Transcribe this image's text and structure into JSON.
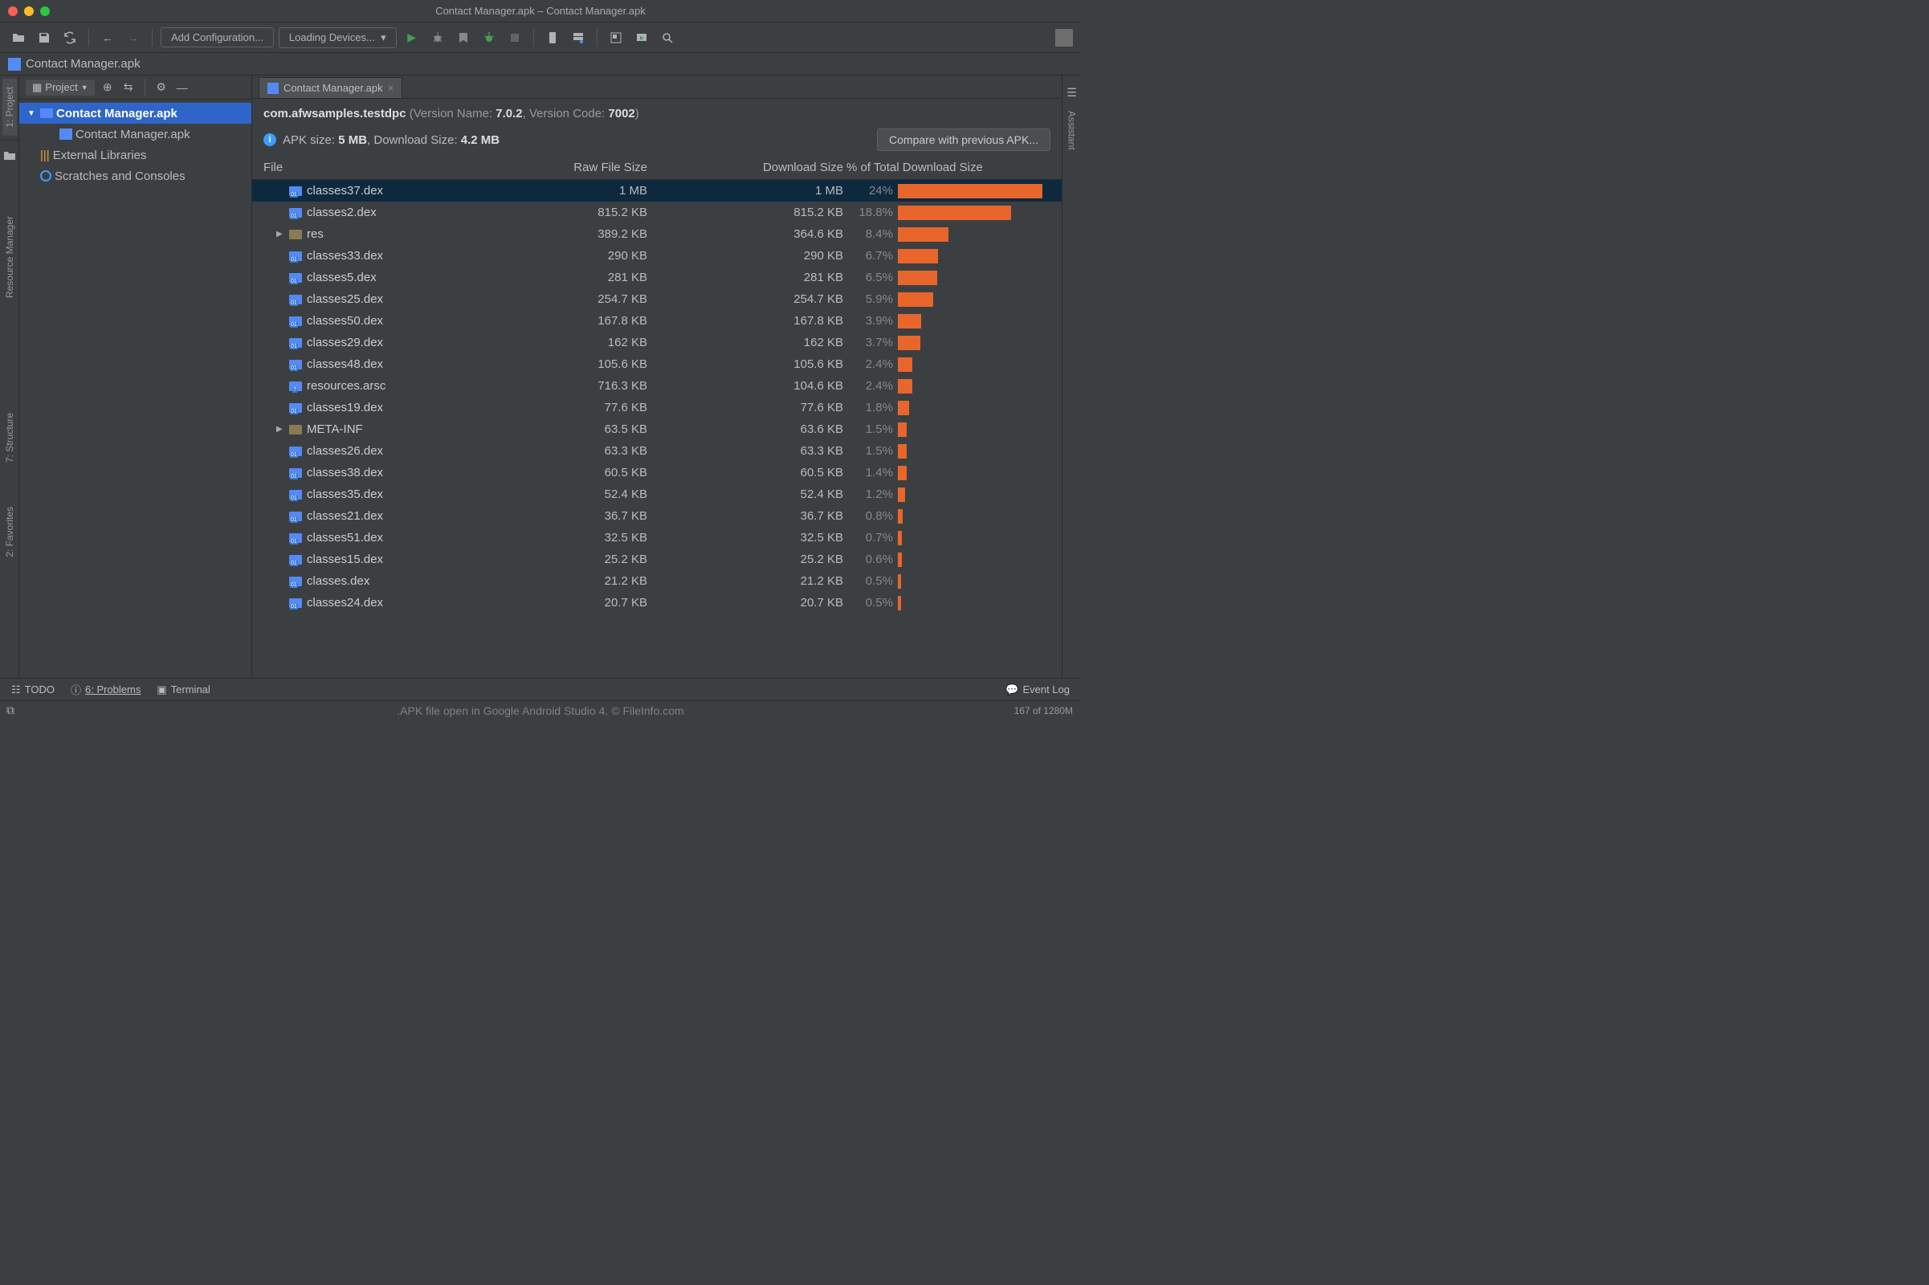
{
  "title": "Contact Manager.apk – Contact Manager.apk",
  "toolbar": {
    "add_config": "Add Configuration...",
    "loading_dev": "Loading Devices..."
  },
  "crumb": "Contact Manager.apk",
  "left_gutter": [
    "1: Project",
    "Resource Manager",
    "7: Structure",
    "2: Favorites"
  ],
  "right_gutter": [
    "Assistant"
  ],
  "sidebar": {
    "title": "Project",
    "tree": [
      {
        "label": "Contact Manager.apk",
        "sel": true,
        "indent": 0,
        "chev": "▼",
        "icon": "proj"
      },
      {
        "label": "Contact Manager.apk",
        "indent": 1,
        "icon": "apk"
      },
      {
        "label": "External Libraries",
        "indent": 0,
        "icon": "lib"
      },
      {
        "label": "Scratches and Consoles",
        "indent": 0,
        "icon": "scr"
      }
    ]
  },
  "tab_label": "Contact Manager.apk",
  "pkg": {
    "name": "com.afwsamples.testdpc",
    "vname_lbl": " (Version Name: ",
    "vname": "7.0.2",
    "vcode_lbl": ", Version Code: ",
    "vcode": "7002",
    "close": ")"
  },
  "sizes": {
    "pre": "APK size: ",
    "apk": "5 MB",
    "mid": ", Download Size: ",
    "dl": "4.2 MB"
  },
  "cmp_btn": "Compare with previous APK...",
  "headers": {
    "file": "File",
    "raw": "Raw File Size",
    "dl": "Download Size",
    "pct": "% of Total Download Size"
  },
  "rows": [
    {
      "f": "classes37.dex",
      "raw": "1 MB",
      "dl": "1 MB",
      "pct": "24%",
      "bar": 24.0,
      "sel": true,
      "ic": "dex"
    },
    {
      "f": "classes2.dex",
      "raw": "815.2 KB",
      "dl": "815.2 KB",
      "pct": "18.8%",
      "bar": 18.8,
      "ic": "dex"
    },
    {
      "f": "res",
      "raw": "389.2 KB",
      "dl": "364.6 KB",
      "pct": "8.4%",
      "bar": 8.4,
      "ic": "fold",
      "chev": true
    },
    {
      "f": "classes33.dex",
      "raw": "290 KB",
      "dl": "290 KB",
      "pct": "6.7%",
      "bar": 6.7,
      "ic": "dex"
    },
    {
      "f": "classes5.dex",
      "raw": "281 KB",
      "dl": "281 KB",
      "pct": "6.5%",
      "bar": 6.5,
      "ic": "dex"
    },
    {
      "f": "classes25.dex",
      "raw": "254.7 KB",
      "dl": "254.7 KB",
      "pct": "5.9%",
      "bar": 5.9,
      "ic": "dex"
    },
    {
      "f": "classes50.dex",
      "raw": "167.8 KB",
      "dl": "167.8 KB",
      "pct": "3.9%",
      "bar": 3.9,
      "ic": "dex"
    },
    {
      "f": "classes29.dex",
      "raw": "162 KB",
      "dl": "162 KB",
      "pct": "3.7%",
      "bar": 3.7,
      "ic": "dex"
    },
    {
      "f": "classes48.dex",
      "raw": "105.6 KB",
      "dl": "105.6 KB",
      "pct": "2.4%",
      "bar": 2.4,
      "ic": "dex"
    },
    {
      "f": "resources.arsc",
      "raw": "716.3 KB",
      "dl": "104.6 KB",
      "pct": "2.4%",
      "bar": 2.4,
      "ic": "arsc"
    },
    {
      "f": "classes19.dex",
      "raw": "77.6 KB",
      "dl": "77.6 KB",
      "pct": "1.8%",
      "bar": 1.8,
      "ic": "dex"
    },
    {
      "f": "META-INF",
      "raw": "63.5 KB",
      "dl": "63.6 KB",
      "pct": "1.5%",
      "bar": 1.5,
      "ic": "fold",
      "chev": true
    },
    {
      "f": "classes26.dex",
      "raw": "63.3 KB",
      "dl": "63.3 KB",
      "pct": "1.5%",
      "bar": 1.5,
      "ic": "dex"
    },
    {
      "f": "classes38.dex",
      "raw": "60.5 KB",
      "dl": "60.5 KB",
      "pct": "1.4%",
      "bar": 1.4,
      "ic": "dex"
    },
    {
      "f": "classes35.dex",
      "raw": "52.4 KB",
      "dl": "52.4 KB",
      "pct": "1.2%",
      "bar": 1.2,
      "ic": "dex"
    },
    {
      "f": "classes21.dex",
      "raw": "36.7 KB",
      "dl": "36.7 KB",
      "pct": "0.8%",
      "bar": 0.8,
      "ic": "dex"
    },
    {
      "f": "classes51.dex",
      "raw": "32.5 KB",
      "dl": "32.5 KB",
      "pct": "0.7%",
      "bar": 0.7,
      "ic": "dex"
    },
    {
      "f": "classes15.dex",
      "raw": "25.2 KB",
      "dl": "25.2 KB",
      "pct": "0.6%",
      "bar": 0.6,
      "ic": "dex"
    },
    {
      "f": "classes.dex",
      "raw": "21.2 KB",
      "dl": "21.2 KB",
      "pct": "0.5%",
      "bar": 0.5,
      "ic": "dex"
    },
    {
      "f": "classes24.dex",
      "raw": "20.7 KB",
      "dl": "20.7 KB",
      "pct": "0.5%",
      "bar": 0.5,
      "ic": "dex"
    }
  ],
  "status": {
    "todo": "TODO",
    "problems": "6: Problems",
    "terminal": "Terminal",
    "event_log": "Event Log"
  },
  "footer": {
    "caption": ".APK file open in Google Android Studio 4. © FileInfo.com",
    "mem": "167 of 1280M"
  }
}
